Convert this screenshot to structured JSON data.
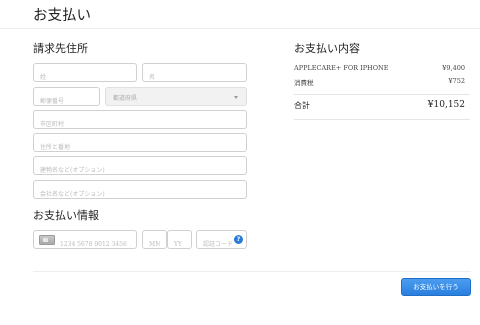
{
  "page": {
    "title": "お支払い"
  },
  "billing": {
    "title": "請求先住所",
    "last_name_placeholder": "姓",
    "first_name_placeholder": "名",
    "postal_placeholder": "郵便番号",
    "prefecture_value": "都道府県",
    "city_placeholder": "市区町村",
    "street_placeholder": "住所と番地",
    "building_placeholder": "建物名など(オプション)",
    "company_placeholder": "会社名など(オプション)"
  },
  "payment": {
    "title": "お支払い情報",
    "card_icon": "credit-card-icon",
    "card_number_placeholder": "1234 5678 9012 3456",
    "month_placeholder": "MM",
    "year_placeholder": "YY",
    "security_code_placeholder": "認証コード",
    "info_icon_glyph": "?"
  },
  "summary": {
    "title": "お支払い内容",
    "items": [
      {
        "label": "APPLECARE+ FOR IPHONE",
        "value": "¥9,400"
      },
      {
        "label": "消費税",
        "value": "¥752"
      }
    ],
    "total_label": "合計",
    "total_value": "¥10,152"
  },
  "actions": {
    "pay_label": "お支払いを行う"
  },
  "colors": {
    "accent": "#2a7fe0",
    "border": "#d0d0d0"
  }
}
